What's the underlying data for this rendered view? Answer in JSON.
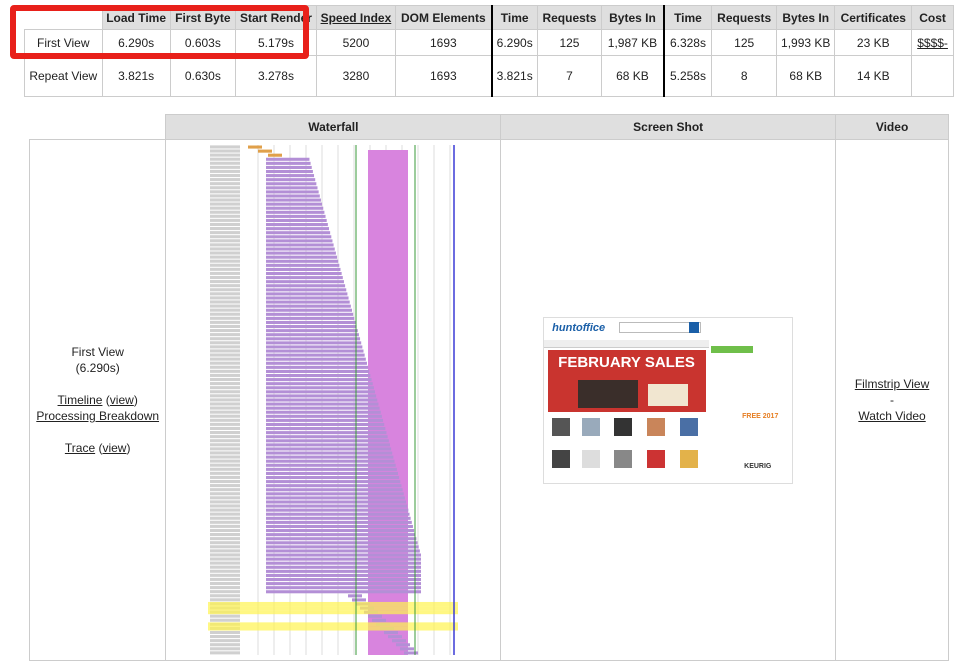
{
  "summary": {
    "headers": [
      "Load Time",
      "First Byte",
      "Start Render",
      "Speed Index",
      "DOM Elements",
      "Time",
      "Requests",
      "Bytes In",
      "Time",
      "Requests",
      "Bytes In",
      "Certificates",
      "Cost"
    ],
    "rows": [
      {
        "label": "First View",
        "cells": [
          "6.290s",
          "0.603s",
          "5.179s",
          "5200",
          "1693",
          "6.290s",
          "125",
          "1,987 KB",
          "6.328s",
          "125",
          "1,993 KB",
          "23 KB",
          "$$$$-"
        ]
      },
      {
        "label": "Repeat View",
        "cells": [
          "3.821s",
          "0.630s",
          "3.278s",
          "3280",
          "1693",
          "3.821s",
          "7",
          "68 KB",
          "5.258s",
          "8",
          "68 KB",
          "14 KB",
          ""
        ]
      }
    ]
  },
  "details": {
    "headers": {
      "waterfall": "Waterfall",
      "screenshot": "Screen Shot",
      "video": "Video"
    },
    "first_view": {
      "label": "First View",
      "time": "(6.290s)",
      "timeline": "Timeline",
      "view": "view",
      "processing": "Processing Breakdown",
      "trace": "Trace"
    },
    "video": {
      "filmstrip": "Filmstrip View",
      "dash": "-",
      "watch": "Watch Video"
    },
    "screenshot": {
      "logo": "huntoffice",
      "banner": "FEBRUARY SALES",
      "side": "FREE 2017",
      "brand": "KEURIG"
    }
  },
  "colors": {
    "highlight": "#e8201a",
    "header": "#dfdfdf",
    "purple": "#b38fd6",
    "pink": "#d884de"
  }
}
